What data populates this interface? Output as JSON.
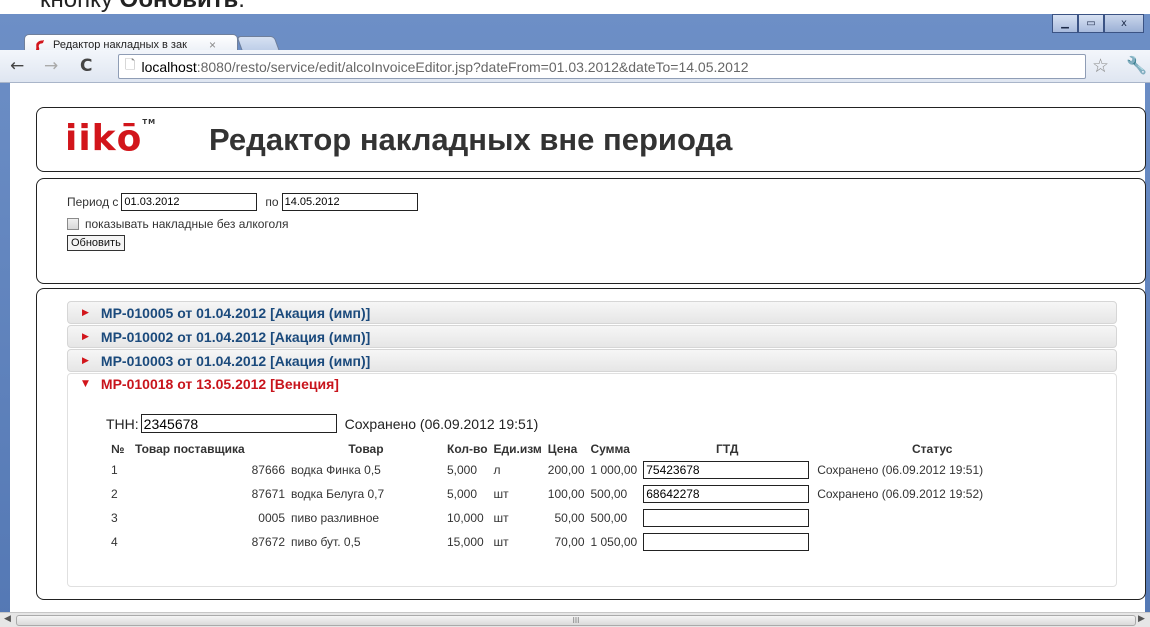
{
  "caption": {
    "text": "кнопку ",
    "bold": "Обновить",
    "tail": "."
  },
  "browser": {
    "tab_title": "Редактор накладных в зак",
    "tab_close": "×",
    "url_host": "localhost",
    "url_rest": ":8080/resto/service/edit/alcoInvoiceEditor.jsp?dateFrom=01.03.2012&dateTo=14.05.2012",
    "win_min": "▁",
    "win_max": "▭",
    "win_close": "x"
  },
  "header": {
    "logo": "iikō",
    "tm": "TM",
    "title": "Редактор накладных вне периода"
  },
  "filter": {
    "period_from_label": "Период с",
    "date_from": "01.03.2012",
    "period_to_label": "по",
    "date_to": "14.05.2012",
    "checkbox_label": "показывать накладные без алкоголя",
    "refresh_button": "Обновить"
  },
  "invoices": [
    {
      "label": "МР-010005 от 01.04.2012 [Акация (имп)]",
      "expanded": false
    },
    {
      "label": "МР-010002 от 01.04.2012 [Акация (имп)]",
      "expanded": false
    },
    {
      "label": "МР-010003 от 01.04.2012 [Акация (имп)]",
      "expanded": false
    },
    {
      "label": "МР-010018 от 13.05.2012 [Венеция]",
      "expanded": true
    }
  ],
  "invoice_detail": {
    "tnn_label": "ТНН:",
    "tnn_value": "2345678",
    "tnn_status": "Сохранено (06.09.2012 19:51)",
    "columns": [
      "№",
      "Товар поставщика",
      "Товар",
      "Кол-во",
      "Еди.изм",
      "Цена",
      "Сумма",
      "ГТД",
      "Статус"
    ],
    "rows": [
      {
        "n": "1",
        "supplier_item": "",
        "code": "87666",
        "item": "водка Финка 0,5",
        "qty": "5,000",
        "unit": "л",
        "price": "200,00",
        "sum": "1 000,00",
        "gtd": "75423678",
        "status": "Сохранено (06.09.2012 19:51)"
      },
      {
        "n": "2",
        "supplier_item": "",
        "code": "87671",
        "item": "водка Белуга 0,7",
        "qty": "5,000",
        "unit": "шт",
        "price": "100,00",
        "sum": "500,00",
        "gtd": "68642278",
        "status": "Сохранено (06.09.2012 19:52)"
      },
      {
        "n": "3",
        "supplier_item": "",
        "code": "0005",
        "item": "пиво разливное",
        "qty": "10,000",
        "unit": "шт",
        "price": "50,00",
        "sum": "500,00",
        "gtd": "",
        "status": ""
      },
      {
        "n": "4",
        "supplier_item": "",
        "code": "87672",
        "item": "пиво бут. 0,5",
        "qty": "15,000",
        "unit": "шт",
        "price": "70,00",
        "sum": "1 050,00",
        "gtd": "",
        "status": ""
      }
    ]
  },
  "scrollbar": {
    "thumb_grip": "III",
    "left_arrow": "◀",
    "right_arrow": "▶"
  }
}
